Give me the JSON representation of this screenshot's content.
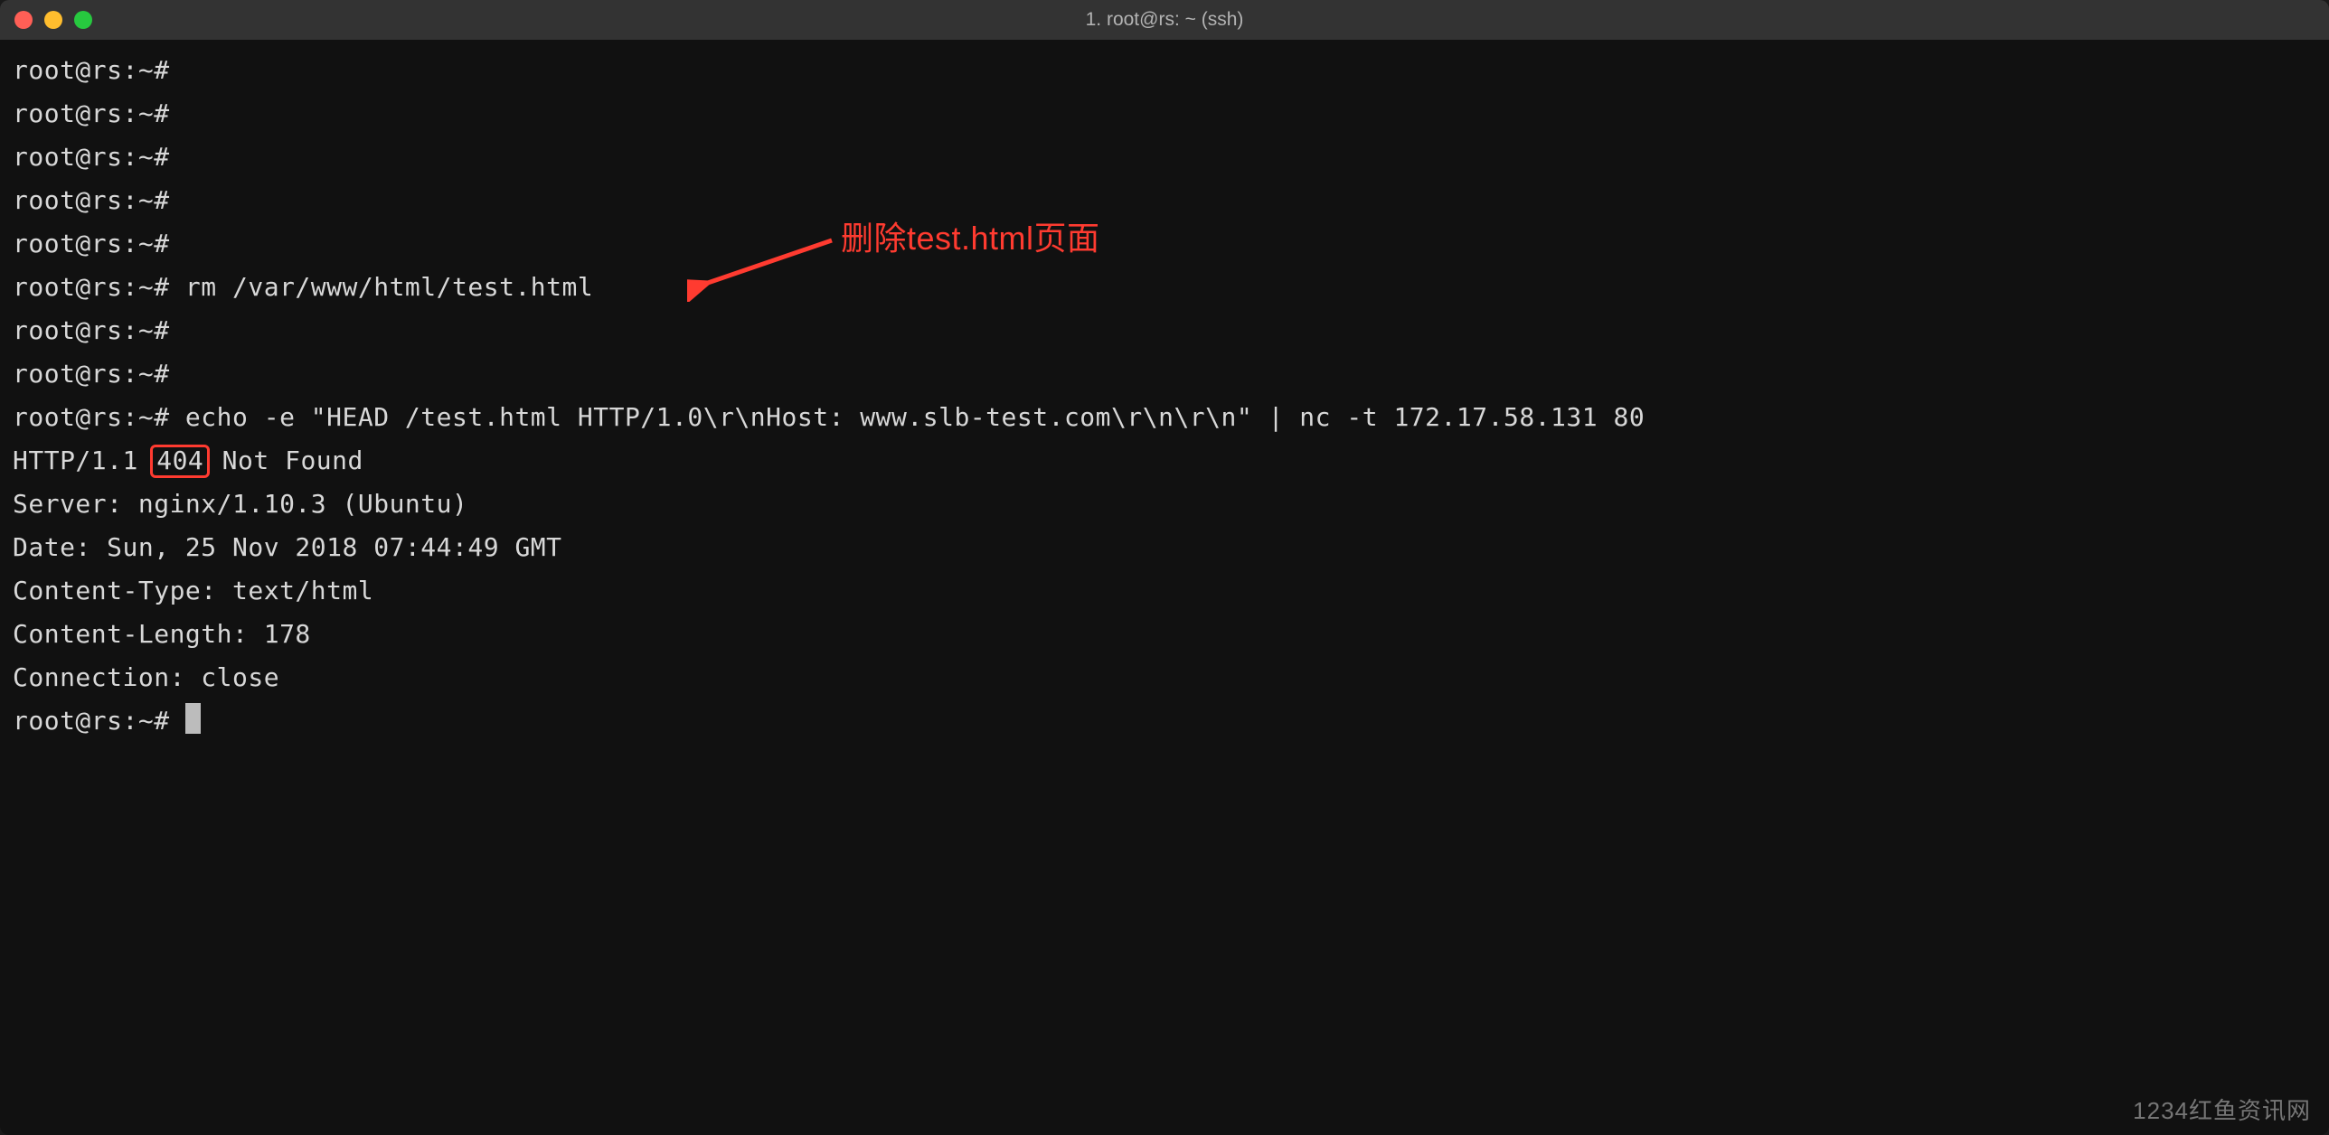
{
  "window": {
    "title": "1. root@rs: ~ (ssh)"
  },
  "terminal": {
    "prompt": "root@rs:~#",
    "lines": {
      "l1": "root@rs:~#",
      "l2": "root@rs:~#",
      "l3": "root@rs:~#",
      "l4": "root@rs:~#",
      "l5": "root@rs:~#",
      "l6": "root@rs:~# rm /var/www/html/test.html",
      "l7": "root@rs:~#",
      "l8": "root@rs:~#",
      "l9": "root@rs:~# echo -e \"HEAD /test.html HTTP/1.0\\r\\nHost: www.slb-test.com\\r\\n\\r\\n\" | nc -t 172.17.58.131 80",
      "resp_pre": "HTTP/1.1 ",
      "resp_code": "404",
      "resp_post": " Not Found",
      "resp2": "Server: nginx/1.10.3 (Ubuntu)",
      "resp3": "Date: Sun, 25 Nov 2018 07:44:49 GMT",
      "resp4": "Content-Type: text/html",
      "resp5": "Content-Length: 178",
      "resp6": "Connection: close",
      "blank": "",
      "final_prompt": "root@rs:~# "
    }
  },
  "annotation": {
    "text": "删除test.html页面"
  },
  "watermark": "1234红鱼资讯网"
}
